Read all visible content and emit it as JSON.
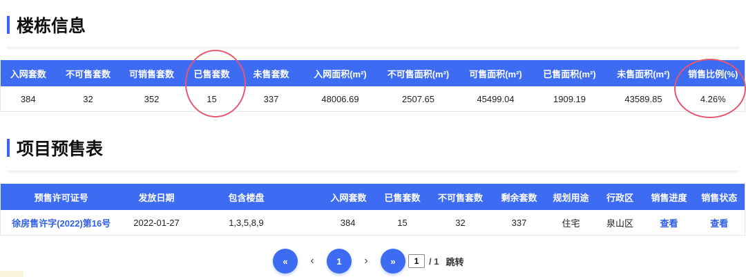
{
  "section1": {
    "title": "楼栋信息",
    "headers": [
      "入网套数",
      "不可售套数",
      "可销售套数",
      "已售套数",
      "未售套数",
      "入网面积(m²)",
      "不可售面积(m²)",
      "可售面积(m²)",
      "已售面积(m²)",
      "未售面积(m²)",
      "销售比例(%)"
    ],
    "row": [
      "384",
      "32",
      "352",
      "15",
      "337",
      "48006.69",
      "2507.65",
      "45499.04",
      "1909.19",
      "43589.85",
      "4.26%"
    ]
  },
  "section2": {
    "title": "项目预售表",
    "headers": [
      "预售许可证号",
      "发放日期",
      "包含楼盘",
      "入网套数",
      "已售套数",
      "不可售套数",
      "剩余套数",
      "规划用途",
      "行政区",
      "销售进度",
      "销售状态"
    ],
    "row": {
      "permit": "徐房售许字(2022)第16号",
      "date": "2022-01-27",
      "buildings": "1,3,5,8,9",
      "total": "384",
      "sold": "15",
      "unsellable": "32",
      "remaining": "337",
      "usage": "住宅",
      "district": "泉山区",
      "progress": "查看",
      "status": "查看"
    }
  },
  "pagination": {
    "first": "«",
    "prev": "‹",
    "current": "1",
    "next": "›",
    "last": "»",
    "input_value": "1",
    "total": "/ 1",
    "jump": "跳转"
  },
  "colors": {
    "accent": "#3d6cf2",
    "highlight_circle": "#e8566e"
  }
}
